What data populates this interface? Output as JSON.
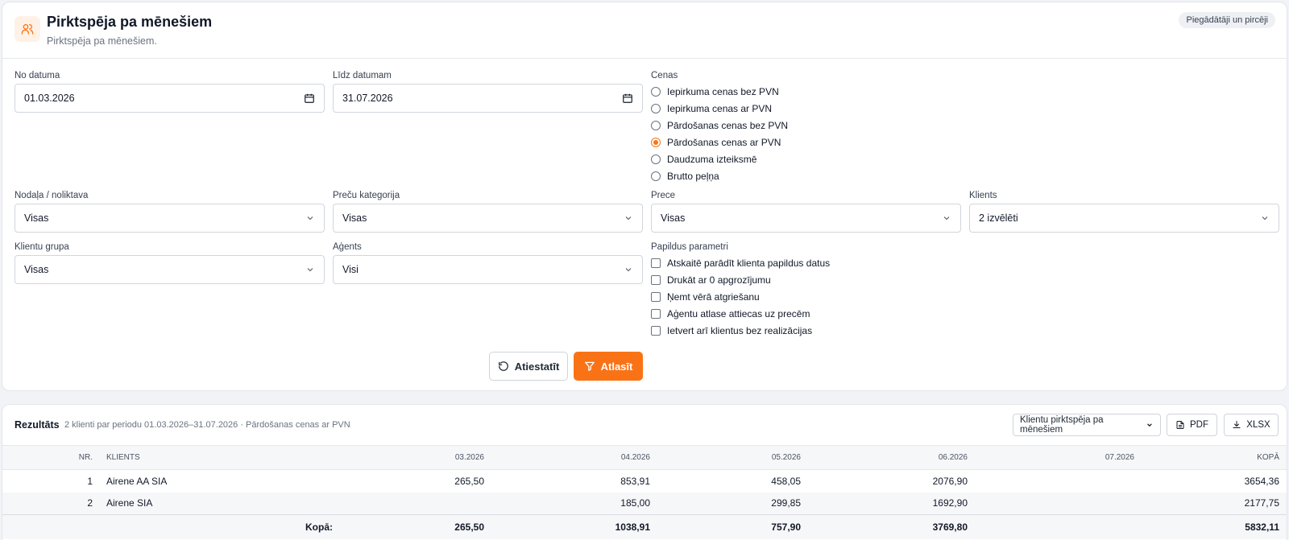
{
  "header": {
    "title": "Pirktspēja pa mēnešiem",
    "subtitle": "Pirktspēja pa mēnešiem.",
    "badge": "Piegādātāji un pircēji"
  },
  "filters": {
    "date_from_label": "No datuma",
    "date_from_value": "01.03.2026",
    "date_to_label": "Līdz datumam",
    "date_to_value": "31.07.2026",
    "prices_label": "Cenas",
    "price_options": [
      {
        "label": "Iepirkuma cenas bez PVN",
        "checked": false
      },
      {
        "label": "Iepirkuma cenas ar PVN",
        "checked": false
      },
      {
        "label": "Pārdošanas cenas bez PVN",
        "checked": false
      },
      {
        "label": "Pārdošanas cenas ar PVN",
        "checked": true
      },
      {
        "label": "Daudzuma izteiksmē",
        "checked": false
      },
      {
        "label": "Brutto peļņa",
        "checked": false
      }
    ],
    "department_label": "Nodaļa / noliktava",
    "department_value": "Visas",
    "category_label": "Preču kategorija",
    "category_value": "Visas",
    "product_label": "Prece",
    "product_value": "Visas",
    "clients_label": "Klients",
    "clients_value": "2 izvēlēti",
    "client_group_label": "Klientu grupa",
    "client_group_value": "Visas",
    "agents_label": "Aģents",
    "agents_value": "Visi",
    "extra_label": "Papildus parametri",
    "extra_options": [
      {
        "label": "Atskaitē parādīt klienta papildus datus",
        "checked": false
      },
      {
        "label": "Drukāt ar 0 apgrozījumu",
        "checked": false
      },
      {
        "label": "Ņemt vērā atgriešanu",
        "checked": false
      },
      {
        "label": "Aģentu atlase attiecas uz precēm",
        "checked": false
      },
      {
        "label": "Ietvert arī klientus bez realizācijas",
        "checked": false
      }
    ],
    "reset_label": "Atiestatīt",
    "apply_label": "Atlasīt"
  },
  "results": {
    "title": "Rezultāts",
    "summary": "2 klienti par periodu 01.03.2026–31.07.2026 · Pārdošanas cenas ar PVN",
    "report_select": "Klientu pirktspēja pa mēnešiem",
    "pdf_label": "PDF",
    "xlsx_label": "XLSX",
    "columns": [
      "NR.",
      "KLIENTS",
      "03.2026",
      "04.2026",
      "05.2026",
      "06.2026",
      "07.2026",
      "KOPĀ"
    ],
    "rows": [
      {
        "nr": "1",
        "client": "Airene AA SIA",
        "m03": "265,50",
        "m04": "853,91",
        "m05": "458,05",
        "m06": "2076,90",
        "m07": "",
        "total": "3654,36"
      },
      {
        "nr": "2",
        "client": "Airene SIA",
        "m03": "",
        "m04": "185,00",
        "m05": "299,85",
        "m06": "1692,90",
        "m07": "",
        "total": "2177,75"
      }
    ],
    "totals": {
      "label": "Kopā:",
      "m03": "265,50",
      "m04": "1038,91",
      "m05": "757,90",
      "m06": "3769,80",
      "m07": "",
      "total": "5832,11"
    }
  },
  "colors": {
    "accent": "#f97316"
  }
}
